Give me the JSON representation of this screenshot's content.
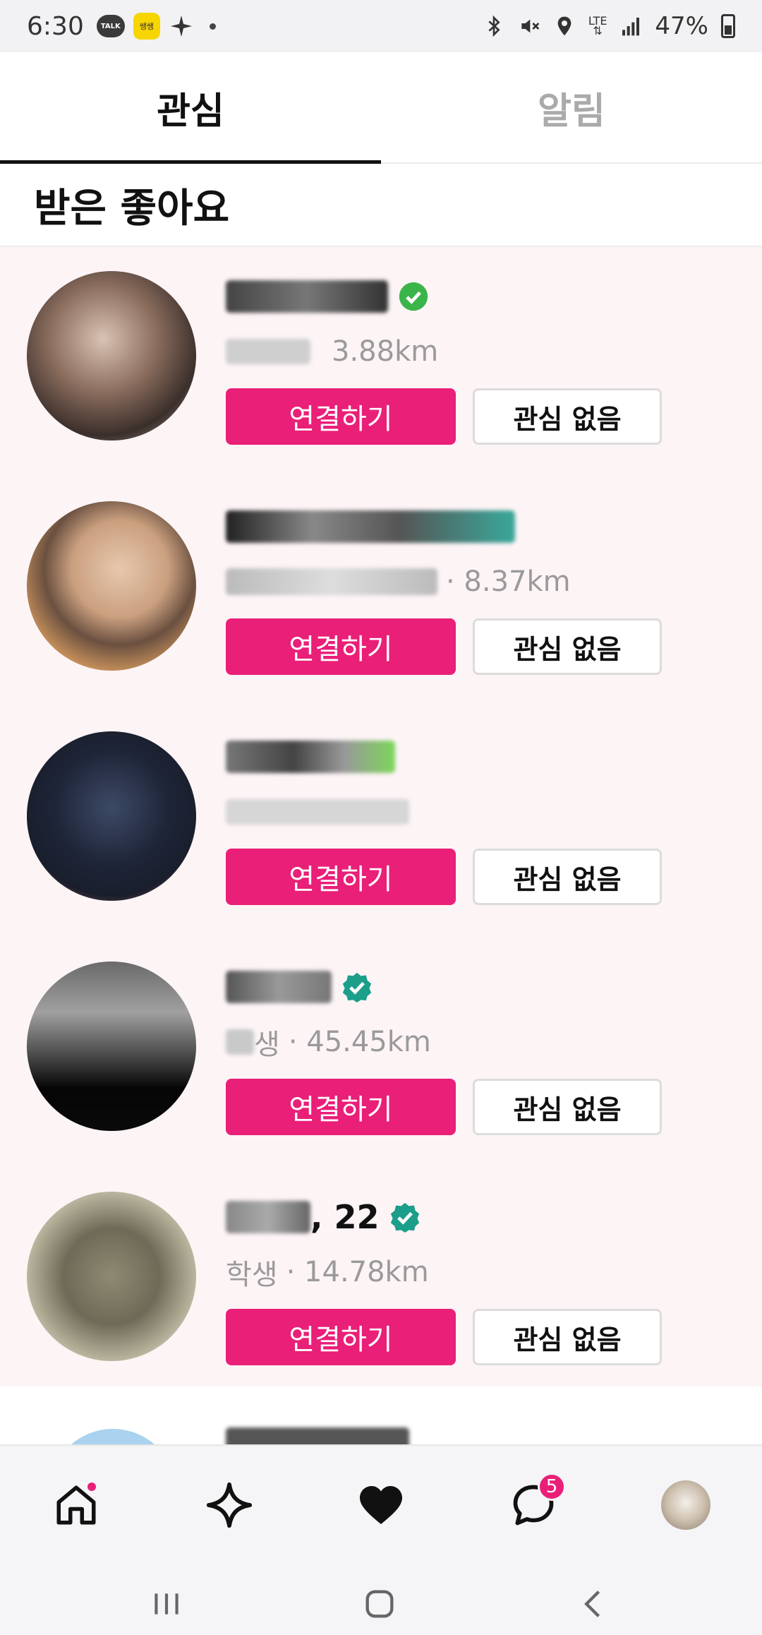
{
  "status_bar": {
    "time": "6:30",
    "talk_label": "TALK",
    "app_badge_label": "쌩쌩",
    "lte_label": "LTE",
    "battery": "47%"
  },
  "tabs": [
    {
      "label": "관심",
      "active": true
    },
    {
      "label": "알림",
      "active": false
    }
  ],
  "section_title": "받은 좋아요",
  "people": [
    {
      "name_suffix": "",
      "job_prefix": "",
      "distance": "3.88km",
      "connect_label": "연결하기",
      "dismiss_label": "관심 없음"
    },
    {
      "name_suffix": "",
      "job_prefix": "",
      "distance": "· 8.37km",
      "connect_label": "연결하기",
      "dismiss_label": "관심 없음"
    },
    {
      "name_suffix": "",
      "job_prefix": "",
      "distance": "",
      "connect_label": "연결하기",
      "dismiss_label": "관심 없음"
    },
    {
      "name_suffix": "",
      "job_prefix": "생",
      "distance": "· 45.45km",
      "connect_label": "연결하기",
      "dismiss_label": "관심 없음"
    },
    {
      "name_suffix": ", 22",
      "job_prefix": "학생",
      "distance": "· 14.78km",
      "connect_label": "연결하기",
      "dismiss_label": "관심 없음"
    }
  ],
  "bottom_nav": {
    "chat_badge": "5"
  },
  "colors": {
    "accent": "#e91f78",
    "verified_green": "#3bb54a",
    "verified_teal": "#1b9e8a",
    "list_bg": "#fdf4f6"
  },
  "icons": {
    "home": "home-icon",
    "explore": "sparkle-icon",
    "likes": "heart-icon",
    "chat": "chat-bubble-icon",
    "profile": "profile-avatar"
  }
}
